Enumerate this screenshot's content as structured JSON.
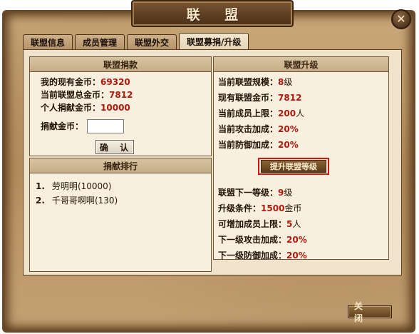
{
  "window": {
    "title": "联 盟",
    "close_icon": "✕"
  },
  "tabs": [
    {
      "label": "联盟信息"
    },
    {
      "label": "成员管理"
    },
    {
      "label": "联盟外交"
    },
    {
      "label": "联盟募捐/升级",
      "active": true
    }
  ],
  "donate": {
    "header": "联盟捐款",
    "my_gold_label": "我的现有金币：",
    "my_gold_value": "69320",
    "total_gold_label": "当前联盟总金币：",
    "total_gold_value": "7812",
    "personal_label": "个人捐献金币：",
    "personal_value": "10000",
    "input_label": "捐献金币：",
    "input_value": "",
    "confirm_label": "确 认"
  },
  "ranking": {
    "header": "捐献排行",
    "items": [
      {
        "rank": "1.",
        "name": "劳明明",
        "amount": "(10000)"
      },
      {
        "rank": "2.",
        "name": "千哥哥啊啊",
        "amount": "(130)"
      }
    ]
  },
  "upgrade": {
    "header": "联盟升级",
    "scale_label": "当前联盟规模：",
    "scale_value": "8",
    "scale_unit": "级",
    "gold_label": "现有联盟金币：",
    "gold_value": "7812",
    "members_label": "当前成员上限：",
    "members_value": "200",
    "members_unit": "人",
    "attack_label": "当前攻击加成：",
    "attack_value": "20%",
    "defense_label": "当前防御加成：",
    "defense_value": "20%",
    "button_label": "提升联盟等级",
    "next_level_label": "联盟下一等级：",
    "next_level_value": "9",
    "next_level_unit": "级",
    "cost_label": "升级条件：",
    "cost_value": "1500",
    "cost_unit": "金币",
    "add_members_label": "可增加成员上限：",
    "add_members_value": "5",
    "add_members_unit": "人",
    "next_attack_label": "下一级攻击加成：",
    "next_attack_value": "20%",
    "next_defense_label": "下一级防御加成：",
    "next_defense_value": "20%"
  },
  "footer": {
    "close_label": "关 闭"
  },
  "colors": {
    "accent_value": "#b3180c",
    "highlight_border": "#d0150c"
  }
}
